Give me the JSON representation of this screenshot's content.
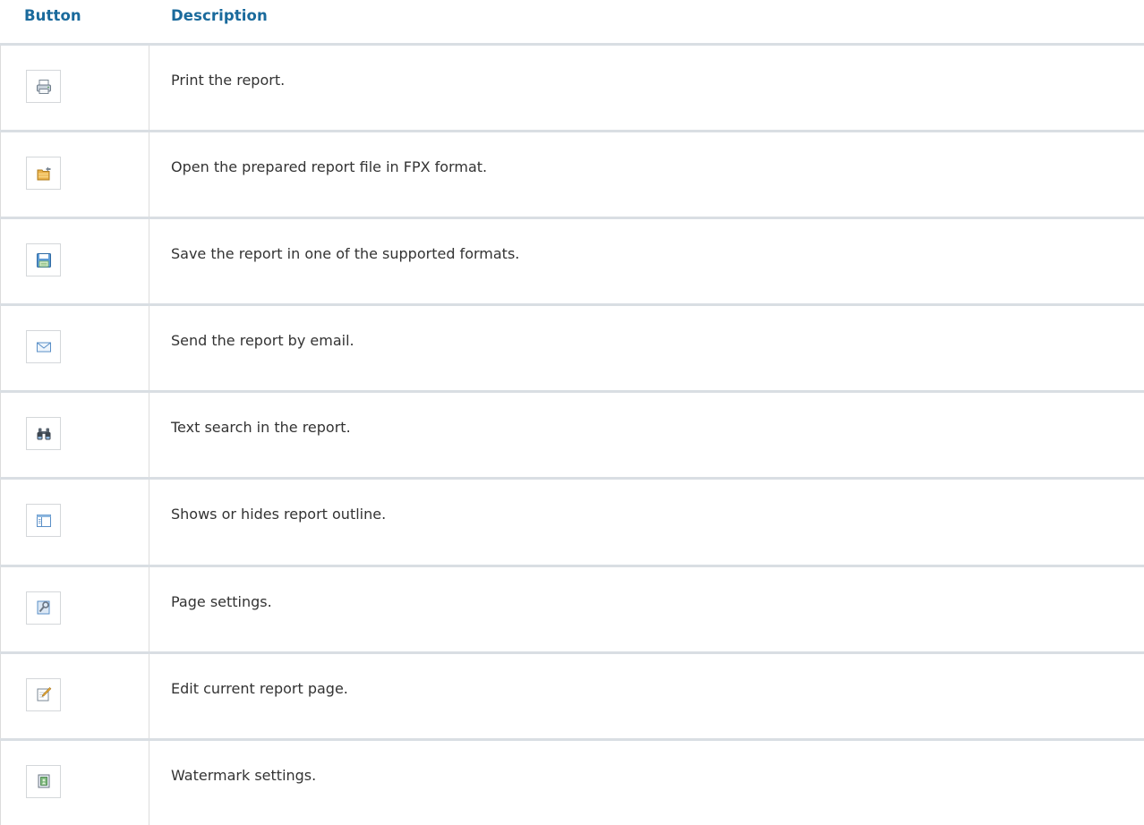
{
  "table": {
    "headers": {
      "button": "Button",
      "description": "Description"
    },
    "rows": [
      {
        "icon": "printer-icon",
        "description": "Print the report."
      },
      {
        "icon": "open-folder-icon",
        "description": "Open the prepared report file in FPX format."
      },
      {
        "icon": "save-disk-icon",
        "description": "Save the report in one of the supported formats."
      },
      {
        "icon": "envelope-icon",
        "description": "Send the report by email."
      },
      {
        "icon": "binoculars-icon",
        "description": "Text search in the report."
      },
      {
        "icon": "outline-panel-icon",
        "description": "Shows or hides report outline."
      },
      {
        "icon": "page-settings-icon",
        "description": "Page settings."
      },
      {
        "icon": "edit-page-icon",
        "description": "Edit current report page."
      },
      {
        "icon": "watermark-icon",
        "description": "Watermark settings."
      }
    ]
  },
  "colors": {
    "header_text": "#1a6a9c",
    "row_separator": "#d9dee3",
    "cell_border": "#dcdcdc",
    "body_text": "#333333"
  }
}
